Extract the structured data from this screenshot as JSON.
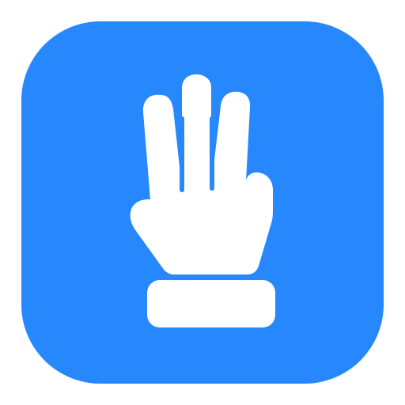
{
  "icon": {
    "name": "three-fingers-hand-icon",
    "background_color": "#2788FD",
    "glyph_color": "#FFFFFF"
  }
}
